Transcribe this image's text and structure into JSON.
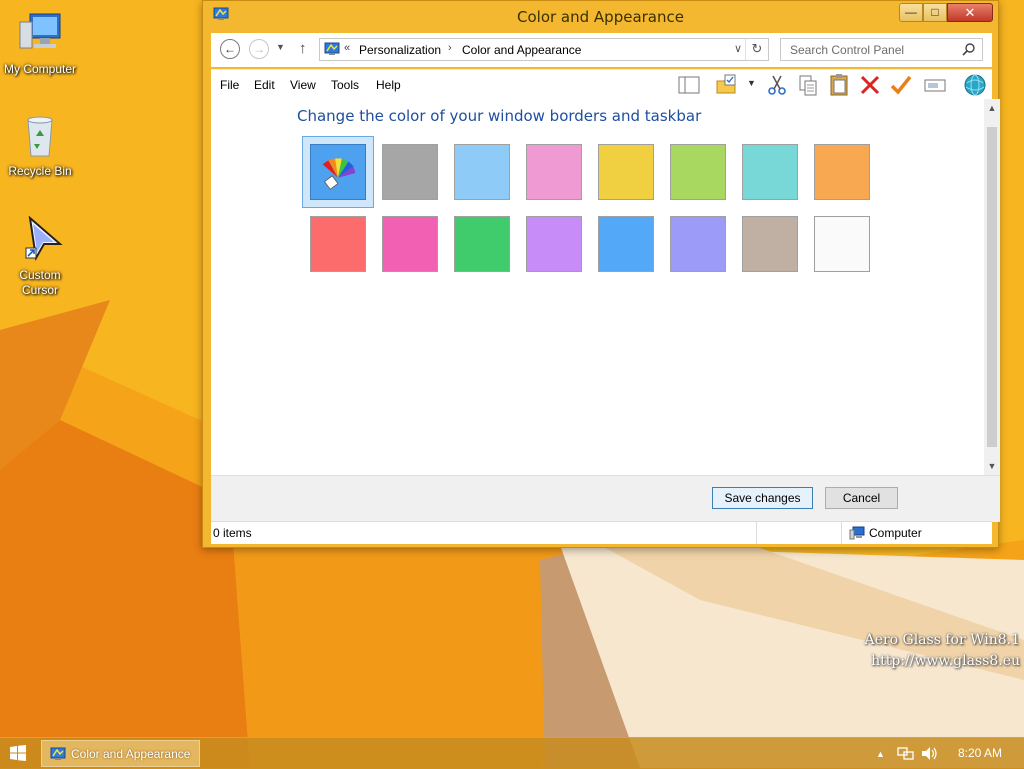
{
  "desktop": {
    "icons": [
      {
        "label": "My Computer"
      },
      {
        "label": "Recycle Bin"
      },
      {
        "label_line1": "Custom",
        "label_line2": "Cursor"
      }
    ],
    "watermark_line1": "Aero Glass for Win8.1",
    "watermark_line2": "http://www.glass8.eu"
  },
  "window": {
    "title": "Color and Appearance",
    "caption_buttons": {
      "minimize": "—",
      "maximize": "□",
      "close": "✕"
    },
    "nav": {
      "back": "←",
      "forward": "→",
      "up": "↑",
      "breadcrumb_sep": "«",
      "crumbs": [
        "Personalization",
        "Color and Appearance"
      ],
      "search_placeholder": "Search Control Panel"
    },
    "menu": [
      "File",
      "Edit",
      "View",
      "Tools",
      "Help"
    ],
    "toolbar_icons": [
      "layout-icon",
      "folder-properties-icon",
      "cut-icon",
      "copy-icon",
      "paste-icon",
      "delete-icon",
      "check-icon",
      "rename-icon",
      "globe-icon"
    ],
    "heading": "Change the color of your window borders and taskbar",
    "color_rows": [
      [
        "auto-color",
        "#a6a6a6",
        "#8ecbf7",
        "#f09ad4",
        "#f0d040",
        "#a8d860",
        "#78d8d8",
        "#f8a850"
      ],
      [
        "#fc6c6c",
        "#f260b4",
        "#40cc6c",
        "#c88cf8",
        "#54a8f8",
        "#9c9cf8",
        "#c0b0a4",
        "#fafafa"
      ]
    ],
    "buttons": {
      "save": "Save changes",
      "cancel": "Cancel"
    },
    "status": {
      "items": "0 items",
      "location": "Computer"
    }
  },
  "taskbar": {
    "task_label": "Color and Appearance",
    "tray_arrow": "▲",
    "clock": "8:20 AM"
  }
}
